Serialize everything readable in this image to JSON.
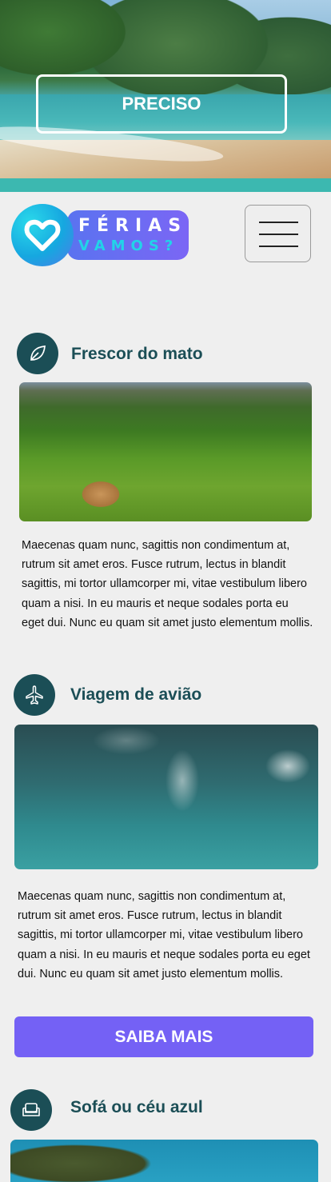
{
  "hero": {
    "button_label": "PRECISO"
  },
  "brand": {
    "title": "FÉRIAS",
    "subtitle": "VAMOS?"
  },
  "sections": [
    {
      "icon": "leaf-icon",
      "title": "Frescor do mato",
      "text": "Maecenas quam nunc, sagittis non condimentum at, rutrum sit amet eros. Fusce rutrum, lectus in blandit sagittis, mi tortor ullamcorper mi, vitae vestibulum libero quam a nisi. In eu mauris et neque sodales porta eu eget dui. Nunc eu quam sit amet justo elementum mollis."
    },
    {
      "icon": "airplane-icon",
      "title": "Viagem de avião",
      "text": "Maecenas quam nunc, sagittis non condimentum at, rutrum sit amet eros. Fusce rutrum, lectus in blandit sagittis, mi tortor ullamcorper mi, vitae vestibulum libero quam a nisi. In eu mauris et neque sodales porta eu eget dui. Nunc eu quam sit amet justo elementum mollis.",
      "button_label": "SAIBA MAIS"
    },
    {
      "icon": "sofa-icon",
      "title": "Sofá ou céu azul"
    }
  ],
  "colors": {
    "accent": "#7461f5",
    "teal": "#3cb8b0",
    "heading": "#1b4e56"
  }
}
